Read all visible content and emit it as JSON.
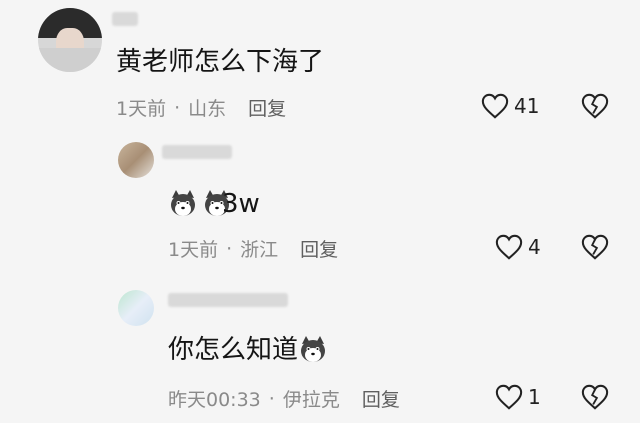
{
  "comments": [
    {
      "text": "黄老师怎么下海了",
      "time": "1天前",
      "location": "山东",
      "reply_label": "回复",
      "likes": "41"
    },
    {
      "text": "3w",
      "time": "1天前",
      "location": "浙江",
      "reply_label": "回复",
      "likes": "4"
    },
    {
      "text": "你怎么知道",
      "time": "昨天00:33",
      "location": "伊拉克",
      "reply_label": "回复",
      "likes": "1"
    }
  ],
  "icons": {
    "like": "heart-outline-icon",
    "dislike": "broken-heart-icon",
    "emoji": "husky-dog-emoji"
  },
  "colors": {
    "background": "#f5f5f5",
    "meta": "#8a8a8a",
    "text": "#151515"
  }
}
